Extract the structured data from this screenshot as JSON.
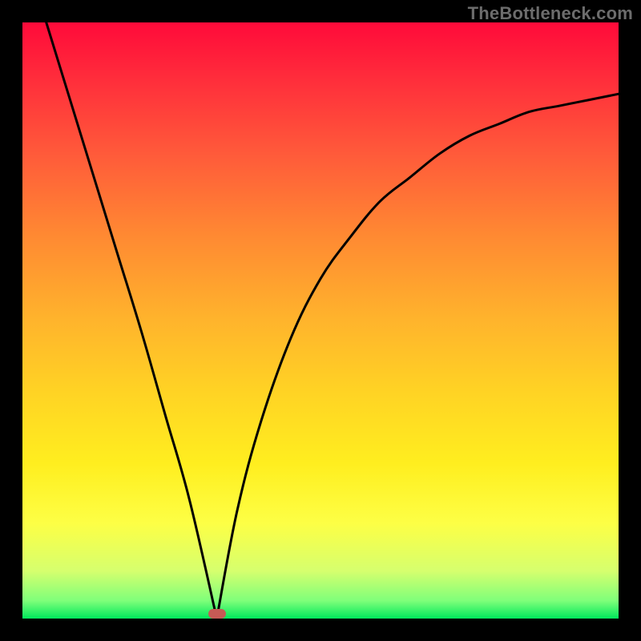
{
  "watermark": "TheBottleneck.com",
  "colors": {
    "background": "#000000",
    "gradient_top": "#ff0a3a",
    "gradient_bottom": "#00e85c",
    "curve": "#000000",
    "marker": "#c65a55",
    "watermark": "#6c6c6c"
  },
  "chart_data": {
    "type": "line",
    "title": "",
    "xlabel": "",
    "ylabel": "",
    "xlim": [
      0,
      100
    ],
    "ylim": [
      0,
      100
    ],
    "grid": false,
    "series": [
      {
        "name": "bottleneck-curve",
        "x": [
          4,
          8,
          12,
          16,
          20,
          24,
          28,
          32.6,
          36,
          40,
          45,
          50,
          55,
          60,
          65,
          70,
          75,
          80,
          85,
          90,
          95,
          100
        ],
        "y": [
          100,
          87,
          74,
          61,
          48,
          34,
          20,
          0,
          18,
          33,
          47,
          57,
          64,
          70,
          74,
          78,
          81,
          83,
          85,
          86,
          87,
          88
        ]
      }
    ],
    "annotations": [
      {
        "name": "minimum-marker",
        "x": 32.6,
        "y": 0.5
      }
    ],
    "notes": "Axes have no visible tick labels; x and y are normalized 0–100 across the plotting area. Values estimated from the rendered curve."
  }
}
